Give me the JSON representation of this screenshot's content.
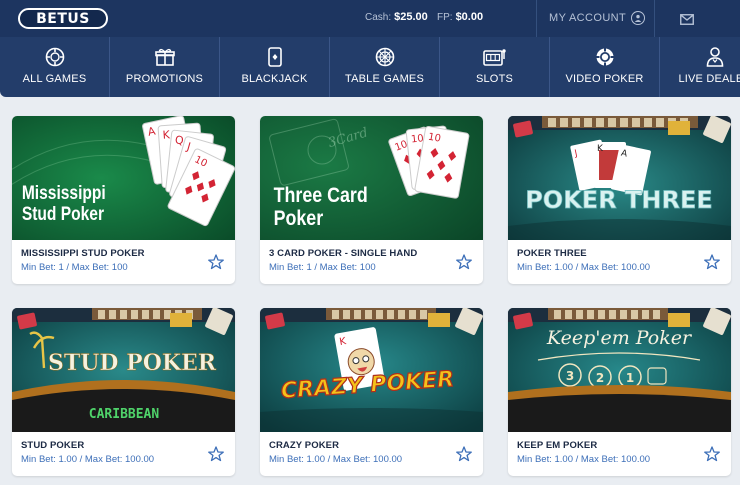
{
  "header": {
    "logo": "BETUS",
    "cash_label": "Cash:",
    "cash_value": "$25.00",
    "fp_label": "FP:",
    "fp_value": "$0.00",
    "account_label": "MY ACCOUNT"
  },
  "nav": {
    "items": [
      {
        "label": "ALL GAMES",
        "icon": "roulette-chip-icon"
      },
      {
        "label": "PROMOTIONS",
        "icon": "gift-icon"
      },
      {
        "label": "BLACKJACK",
        "icon": "card-icon"
      },
      {
        "label": "TABLE GAMES",
        "icon": "roulette-wheel-icon"
      },
      {
        "label": "SLOTS",
        "icon": "slot-machine-icon"
      },
      {
        "label": "VIDEO POKER",
        "icon": "poker-chip-icon"
      },
      {
        "label": "LIVE DEALER",
        "icon": "dealer-icon"
      }
    ]
  },
  "games": [
    {
      "title": "MISSISSIPPI STUD POKER",
      "bet": "Min Bet: 1 / Max Bet: 100",
      "art_text": [
        "Mississippi",
        "Stud Poker"
      ]
    },
    {
      "title": "3 CARD POKER - SINGLE HAND",
      "bet": "Min Bet: 1 / Max Bet: 100",
      "art_text": [
        "Three Card",
        "Poker"
      ]
    },
    {
      "title": "POKER THREE",
      "bet": "Min Bet: 1.00 / Max Bet: 100.00",
      "art_text": [
        "POKER THREE"
      ]
    },
    {
      "title": "STUD POKER",
      "bet": "Min Bet: 1.00 / Max Bet: 100.00",
      "art_text": [
        "STUD POKER",
        "CARIBBEAN"
      ]
    },
    {
      "title": "CRAZY POKER",
      "bet": "Min Bet: 1.00 / Max Bet: 100.00",
      "art_text": [
        "CRAZY POKER"
      ]
    },
    {
      "title": "KEEP EM POKER",
      "bet": "Min Bet: 1.00 / Max Bet: 100.00",
      "art_text": [
        "Keep'em Poker",
        "3",
        "2",
        "1"
      ]
    }
  ],
  "colors": {
    "header_bg": "#1d3560",
    "nav_bg": "#233d6a",
    "page_bg": "#e9edf2",
    "link_blue": "#3d6fb8",
    "felt_green": "#0f6b3a",
    "felt_teal": "#1f6f72",
    "card_red": "#d32434"
  }
}
